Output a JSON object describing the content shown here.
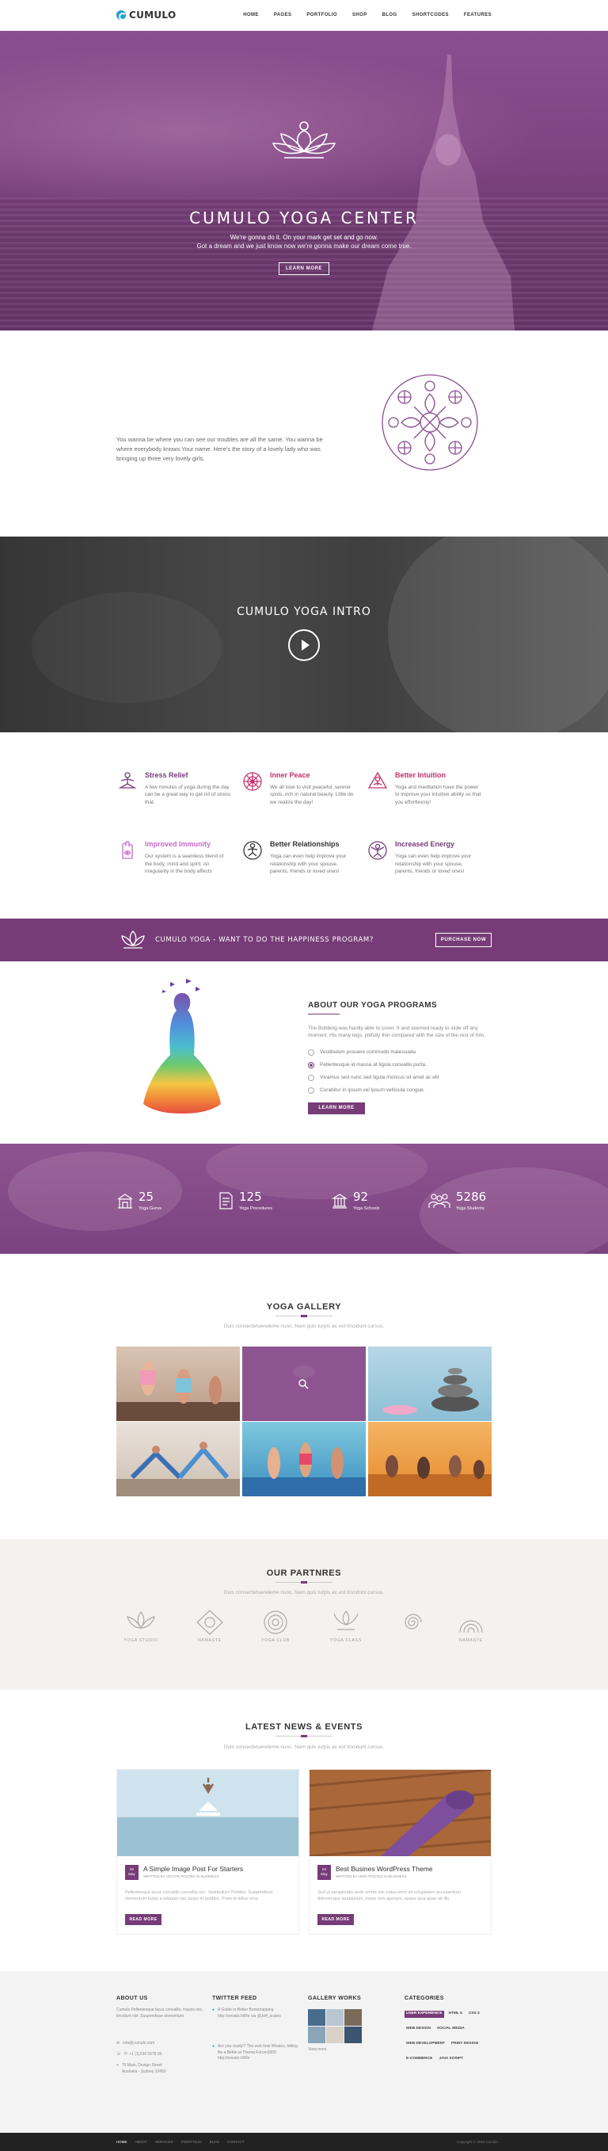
{
  "header": {
    "logo_text": "CUMULO",
    "nav": [
      "HOME",
      "PAGES",
      "PORTFOLIO",
      "SHOP",
      "BLOG",
      "SHORTCODES",
      "FEATURES"
    ]
  },
  "hero": {
    "title": "CUMULO YOGA CENTER",
    "line1": "We're gonna do it. On your mark get set and go now.",
    "line2": "Got a dream and we just know now we're gonna make our dream come true.",
    "button": "LEARN MORE"
  },
  "intro": {
    "text": "You wanna be where you can see our troubles are all the same. You wanna be where everybody knows Your name. Here's the story of a lovely lady who was bringing up three very lovely girls."
  },
  "video": {
    "title": "CUMULO YOGA INTRO"
  },
  "features": [
    {
      "title": "Stress Relief",
      "text": "A few minutes of yoga during the day can be a great way to get rid of stress that.",
      "color": "#773c78",
      "icon": "meditation-icon"
    },
    {
      "title": "Inner Peace",
      "text": "We all love to visit peaceful, serene spots, rich in natural beauty. Little do we realize the day!",
      "color": "#c2306b",
      "icon": "mandala-flower-icon"
    },
    {
      "title": "Better Intuition",
      "text": "Yoga and meditation have the power to improve your intuitive ability so that you effortlessly!",
      "color": "#c2306b",
      "icon": "lotus-pose-icon"
    },
    {
      "title": "Improved Immunity",
      "text": "Our system is a seamless blend of the body, mind and spirit. An irregularity in the body affects",
      "color": "#c76bc9",
      "icon": "hamsa-hand-icon"
    },
    {
      "title": "Better Relationships",
      "text": "Yoga can even help improve your relationship with your spouse, parents, friends or loved ones!",
      "color": "#333333",
      "icon": "yoga-person-icon"
    },
    {
      "title": "Increased Energy",
      "text": "Yoga can even help improve your relationship with your spouse, parents, friends or loved ones!",
      "color": "#773c78",
      "icon": "yoga-arms-icon"
    }
  ],
  "cta": {
    "text": "CUMULO YOGA - WANT TO DO THE HAPPINESS PROGRAM?",
    "button": "PURCHASE NOW"
  },
  "about": {
    "title": "ABOUT OUR YOGA PROGRAMS",
    "text": "The Bobbing was hardly able to cover. It and seemed ready to slide off any moment. His many legs, pitifully thin compared with the size of the rest of him.",
    "options": [
      "Vestibulum posuere commodo malesuada",
      "Pellentesque id massa at ligula convallis porta.",
      "Vivamus sed nunc sed ligula rhoncus sit amet ac elit",
      "Curabitur in ipsum vel ipsum vehicula congue."
    ],
    "selected_option": 1,
    "button": "LEARN MORE"
  },
  "stats": [
    {
      "number": "25",
      "label": "Yoga Gurus",
      "icon": "building-icon"
    },
    {
      "number": "125",
      "label": "Yoga Procedures",
      "icon": "document-icon"
    },
    {
      "number": "92",
      "label": "Yoga Schools",
      "icon": "school-icon"
    },
    {
      "number": "5286",
      "label": "Yoga Students",
      "icon": "students-icon"
    }
  ],
  "gallery": {
    "title": "YOGA GALLERY",
    "subtitle": "Duis consectetuereleme nunc. Nam quis turpis ac est tincidunt cursus."
  },
  "partners": {
    "title": "OUR PARTNRES",
    "subtitle": "Duis consectetuereleme nunc. Nam quis turpis ac est tincidunt cursus.",
    "logos": [
      "YOGA STUDIO",
      "NAMASTE",
      "YOGA CLUB",
      "YOGA CLASS",
      "",
      "NAMASTE"
    ]
  },
  "news": {
    "title": "LATEST NEWS & EVENTS",
    "subtitle": "Duis consectetuereleme nunc. Nam quis turpis ac est tincidunt cursus.",
    "posts": [
      {
        "day": "02",
        "month": "May",
        "title": "A Simple Image Post For Starters",
        "meta": "WRITTEN BY VICTOR   POSTED IN BUSINESS",
        "text": "Pellentesque lacus convallis convallis nec. Vestibulum Porttitor. Suspendisse elementum turpis a aliquam nec turpis et porttitor. Proin et tellus eros.",
        "button": "READ MORE"
      },
      {
        "day": "04",
        "month": "May",
        "title": "Best Busines WordPress Theme",
        "meta": "WRITTEN BY HIRO   POSTED IN BUSINESS",
        "text": "Sed ut perspiciatis unde omnis iste natus error sit voluptatem accusantium doloremque laudantium, totam rem aperiam, eaque ipsa quae ab illo.",
        "button": "READ MORE"
      }
    ]
  },
  "footer": {
    "about_title": "ABOUT US",
    "about_text": "Cumulo Pellentesque lacus convallis, mauris nec, tincidunt nisl. Suspendisse elementum.",
    "email": "info@cumulo.com",
    "phone": "P: +1 (1)234 5678 90",
    "address_1": "76 Main, Design Street",
    "address_2": "Australia - Sydney 33450",
    "twitter_title": "TWITTER FEED",
    "tweet_1": "A Guide to Better Bootstrapping http://envato.hl/Re via @Jeff_scales",
    "tweet_2": "Are you ready!? The web how Wirates, letting Be a Bettie at Thema Forum2005 http://envato.hl/Re",
    "gallery_title": "GALLERY WORKS",
    "view_more": "View more",
    "categories_title": "CATEGORIES",
    "categories": [
      "USER EXPERIENCE",
      "HTML 5",
      "CSS 3",
      "WEB DESIGN",
      "SOCIAL MEDIA",
      "WEB DEVELOPMENT",
      "PRINT DESIGN",
      "E-COMMERCE",
      "JAVA SCRIPT"
    ]
  },
  "bottom": {
    "nav": [
      "HOME",
      "ABOUT",
      "SERVICES",
      "PORTFOLIO",
      "BLOG",
      "CONTACT"
    ],
    "copyright": "Copyright © 2015 Cumulo"
  }
}
